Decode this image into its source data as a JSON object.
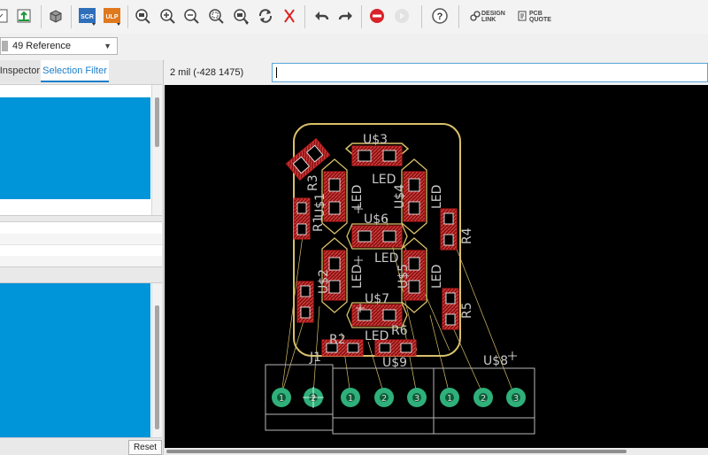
{
  "toolbar": {
    "icons": [
      "document-icon",
      "export-icon",
      "3d-view-icon",
      "script-icon",
      "ulp-icon",
      "zoom-fit-icon",
      "zoom-in-icon",
      "zoom-out-icon",
      "zoom-select-icon",
      "zoom-area-icon",
      "redraw-icon",
      "cancel-icon",
      "undo-icon",
      "redo-icon",
      "stop-icon",
      "go-icon",
      "help-icon",
      "design-link-icon",
      "pcb-quote-icon"
    ],
    "scr_label": "SCR",
    "ulp_label": "ULP",
    "design_link": [
      "DESIGN",
      "LINK"
    ],
    "pcb_quote": [
      "PCB",
      "QUOTE"
    ]
  },
  "layer": {
    "selected": "49 Reference"
  },
  "left_panel": {
    "tabs": [
      "Inspector",
      "Selection Filter"
    ],
    "active_tab": "Selection Filter",
    "reset_label": "Reset"
  },
  "command": {
    "coords": "2 mil (-428 1475)",
    "value": ""
  },
  "board": {
    "labels": {
      "u3": "U$3",
      "led_top": "LED",
      "r3": "R3",
      "u1": "U$1",
      "led_l1": "LED",
      "u4": "U$4",
      "led_r1": "LED",
      "u6": "U$6",
      "led_mid": "LED",
      "r1": "R1",
      "r4": "R4",
      "u2": "U$2",
      "led_l2": "LED",
      "u5": "U$5",
      "led_r2": "LED",
      "u7": "U$7",
      "led_bot": "LED",
      "r2": "R2",
      "r6": "R6",
      "r5": "R5",
      "j1": "J1",
      "u9": "U$9",
      "u8": "U$8"
    },
    "pins": [
      "1",
      "2",
      "1",
      "2",
      "3",
      "1",
      "2",
      "3"
    ]
  },
  "colors": {
    "accent": "#1c7ec9",
    "selection_blue": "#0094d9",
    "pad_red": "#c41e1e",
    "outline_yellow": "#d8c06a",
    "via_green": "#2fb07a"
  }
}
